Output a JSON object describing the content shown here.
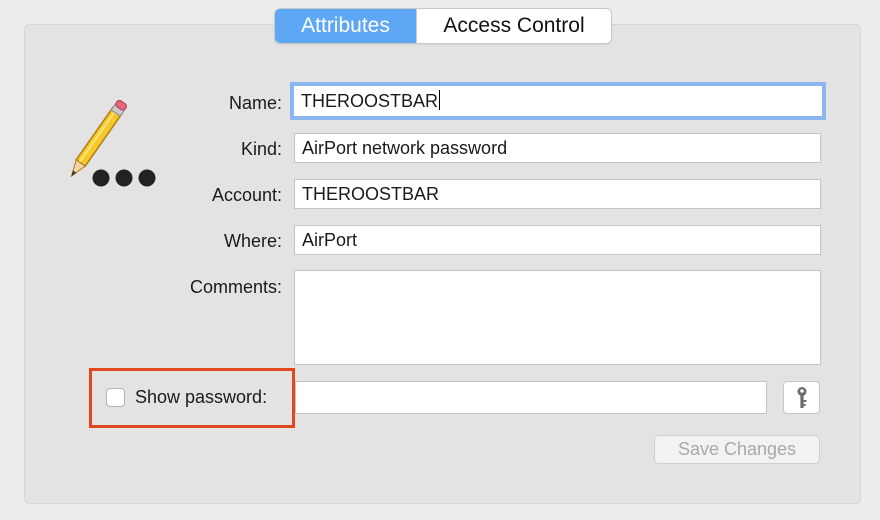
{
  "tabs": [
    {
      "label": "Attributes",
      "active": true
    },
    {
      "label": "Access Control",
      "active": false
    }
  ],
  "icon": {
    "name": "pencil-password-icon"
  },
  "fields": {
    "name": {
      "label": "Name:",
      "value": "THEROOSTBAR",
      "focused": true
    },
    "kind": {
      "label": "Kind:",
      "value": "AirPort network password"
    },
    "account": {
      "label": "Account:",
      "value": "THEROOSTBAR"
    },
    "where": {
      "label": "Where:",
      "value": "AirPort"
    },
    "comments": {
      "label": "Comments:",
      "value": ""
    }
  },
  "show_password": {
    "label": "Show password:",
    "checked": false,
    "value": ""
  },
  "key_button": {
    "icon": "key-icon"
  },
  "save_button": {
    "label": "Save Changes",
    "enabled": false
  },
  "colors": {
    "accent": "#5ea7f4",
    "focus_ring": "#8bb7ee",
    "highlight": "#e0481d",
    "background": "#ececec",
    "panel": "#e3e3e3"
  }
}
